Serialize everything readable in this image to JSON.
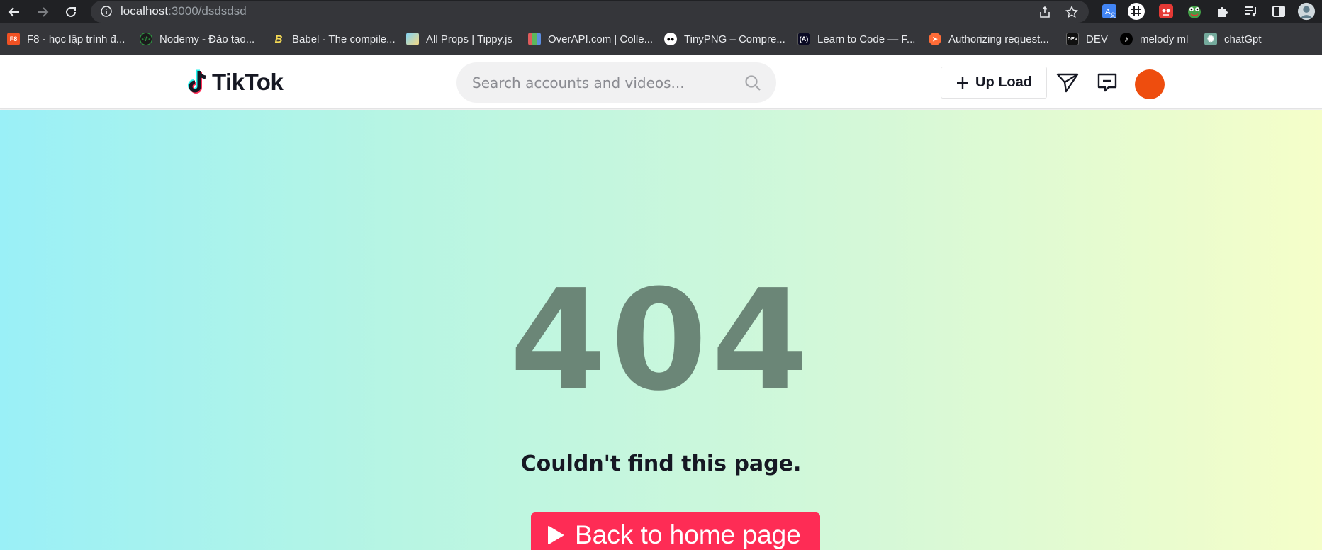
{
  "browser": {
    "url_host": "localhost",
    "url_path": ":3000/dsdsdsd",
    "icons": {
      "back": "arrow-left-icon",
      "forward": "arrow-right-icon",
      "reload": "reload-icon",
      "info": "info-icon",
      "share": "share-icon",
      "star": "star-icon"
    },
    "extensions": [
      "translate-icon",
      "hashtag-icon",
      "mascot-icon",
      "frog-icon",
      "puzzle-icon",
      "media-list-icon",
      "side-panel-icon",
      "profile-icon"
    ]
  },
  "bookmarks": [
    {
      "label": "F8 - học lập trình đ...",
      "icon": "f8-icon",
      "color": "#f05123",
      "glyph": "F8"
    },
    {
      "label": "Nodemy - Đào tạo...",
      "icon": "code-icon",
      "color": "#2f9e44",
      "glyph": "</>"
    },
    {
      "label": "Babel · The compile...",
      "icon": "babel-icon",
      "color": "#f5da55",
      "glyph": "B"
    },
    {
      "label": "All Props | Tippy.js",
      "icon": "tippy-icon",
      "color": "#7fd3f7",
      "glyph": ""
    },
    {
      "label": "OverAPI.com | Colle...",
      "icon": "overapi-icon",
      "color": "#e05c5c",
      "glyph": ""
    },
    {
      "label": "TinyPNG – Compre...",
      "icon": "panda-icon",
      "color": "#ffffff",
      "glyph": ""
    },
    {
      "label": "Learn to Code — F...",
      "icon": "freecodecamp-icon",
      "color": "#0a0a23",
      "glyph": "(A)"
    },
    {
      "label": "Authorizing request...",
      "icon": "postman-icon",
      "color": "#ff6c37",
      "glyph": ""
    },
    {
      "label": "DEV",
      "icon": "dev-icon",
      "color": "#111111",
      "glyph": "DEV"
    },
    {
      "label": "melody ml",
      "icon": "tiktok-icon",
      "color": "#000000",
      "glyph": "♪"
    },
    {
      "label": "chatGpt",
      "icon": "chatgpt-icon",
      "color": "#74aa9c",
      "glyph": "✺"
    }
  ],
  "header": {
    "logo_text": "TikTok",
    "search_placeholder": "Search accounts and videos...",
    "upload_label": "Up Load",
    "icons": [
      "send-icon",
      "message-icon"
    ],
    "avatar_color": "#ee4d0e"
  },
  "main": {
    "code": "404",
    "message": "Couldn't find this page.",
    "home_button": "Back to home page"
  },
  "colors": {
    "accent": "#fe2c55",
    "code_color": "#6b8677"
  }
}
